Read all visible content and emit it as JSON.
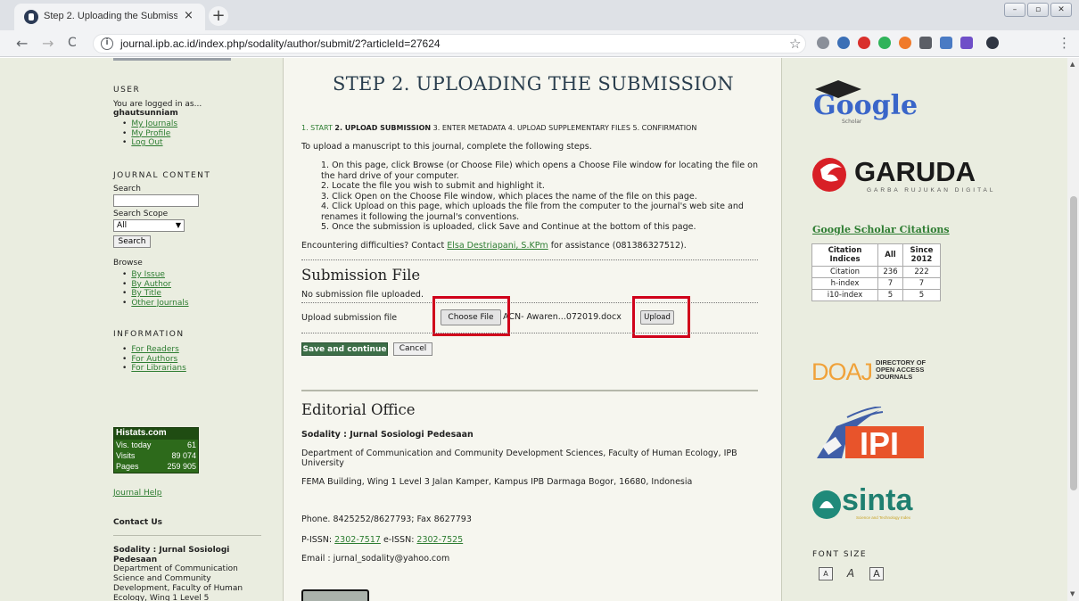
{
  "browser": {
    "tab_title": "Step 2. Uploading the Submission",
    "tab_close": "×",
    "new_tab": "+",
    "url": "journal.ipb.ac.id/index.php/sodality/author/submit/2?articleId=27624",
    "nav": {
      "back": "←",
      "forward": "→",
      "reload": "C"
    },
    "win_min": "–",
    "win_max": "▫",
    "win_close": "✕"
  },
  "sidebar": {
    "user_head": "USER",
    "logged_in": "You are logged in as...",
    "username": "ghautsunniam",
    "user_links": [
      "My Journals",
      "My Profile",
      "Log Out"
    ],
    "journal_content_head": "JOURNAL CONTENT",
    "search_label": "Search",
    "search_scope_label": "Search Scope",
    "search_scope_value": "All",
    "search_button": "Search",
    "browse_label": "Browse",
    "browse_links": [
      "By Issue",
      "By Author",
      "By Title",
      "Other Journals"
    ],
    "information_head": "INFORMATION",
    "info_links": [
      "For Readers",
      "For Authors",
      "For Librarians"
    ],
    "histats": {
      "title": "Histats.com",
      "rows": [
        {
          "label": "Vis. today",
          "value": "61"
        },
        {
          "label": "Visits",
          "value": "89 074"
        },
        {
          "label": "Pages",
          "value": "259 905"
        }
      ]
    },
    "journal_help": "Journal Help",
    "contact_head": "Contact Us",
    "contact_org": "Sodality : Jurnal Sosiologi Pedesaan",
    "contact_lines": [
      "Department of Communication",
      "Science and Community",
      "Development, Faculty of Human",
      "Ecology, Wing 1 Level 5"
    ]
  },
  "main": {
    "title": "STEP 2. UPLOADING THE SUBMISSION",
    "steps": [
      {
        "label": "1. START",
        "state": "link"
      },
      {
        "label": "2. UPLOAD SUBMISSION",
        "state": "active"
      },
      {
        "label": "3. ENTER METADATA",
        "state": "plain"
      },
      {
        "label": "4. UPLOAD SUPPLEMENTARY FILES",
        "state": "plain"
      },
      {
        "label": "5. CONFIRMATION",
        "state": "plain"
      }
    ],
    "intro": "To upload a manuscript to this journal, complete the following steps.",
    "instructions": [
      "1. On this page, click Browse (or Choose File) which opens a Choose File window for locating the file on the hard drive of your computer.",
      "2. Locate the file you wish to submit and highlight it.",
      "3. Click Open on the Choose File window, which places the name of the file on this page.",
      "4. Click Upload on this page, which uploads the file from the computer to the journal's web site and renames it following the journal's conventions.",
      "5. Once the submission is uploaded, click Save and Continue at the bottom of this page."
    ],
    "difficulties_pre": "Encountering difficulties? Contact ",
    "contact_name": "Elsa Destriapani, S.KPm",
    "difficulties_post": " for assistance (081386327512).",
    "submission_file_head": "Submission File",
    "no_file": "No submission file uploaded.",
    "upload_label": "Upload submission file",
    "choose_file_button": "Choose File",
    "chosen_file_name": "ACN- Awaren...072019.docx",
    "upload_button": "Upload",
    "save_button": "Save and continue",
    "cancel_button": "Cancel",
    "editorial_head": "Editorial Office",
    "journal_name": "Sodality : Jurnal Sosiologi Pedesaan",
    "dept": "Department of Communication and Community Development Sciences, Faculty of Human Ecology, IPB University",
    "address": "FEMA Building, Wing 1 Level 3 Jalan Kamper, Kampus IPB Darmaga Bogor, 16680, Indonesia",
    "phone": "Phone. 8425252/8627793; Fax 8627793",
    "pissn_label": "P-ISSN: ",
    "pissn": "2302-7517",
    "eissn_label": " e-ISSN: ",
    "eissn": "2302-7525",
    "email": "Email : jurnal_sodality@yahoo.com"
  },
  "right": {
    "google_text": "Google",
    "google_sub": "Scholar",
    "garuda_text": "GARUDA",
    "garuda_sub": "GARBA RUJUKAN DIGITAL",
    "gs_citations": "Google Scholar Citations",
    "table": {
      "headers": [
        "Citation Indices",
        "All",
        "Since 2012"
      ],
      "rows": [
        [
          "Citation",
          "236",
          "222"
        ],
        [
          "h-index",
          "7",
          "7"
        ],
        [
          "i10-index",
          "5",
          "5"
        ]
      ]
    },
    "doaj_text": "DOAJ",
    "doaj_sub": [
      "DIRECTORY OF",
      "OPEN ACCESS",
      "JOURNALS"
    ],
    "ipi_text": "IPI",
    "sinta_text": "sinta",
    "sinta_sub": "Science and Technology Index",
    "font_size_head": "FONT SIZE",
    "font_buttons": [
      "A",
      "A",
      "A"
    ]
  }
}
